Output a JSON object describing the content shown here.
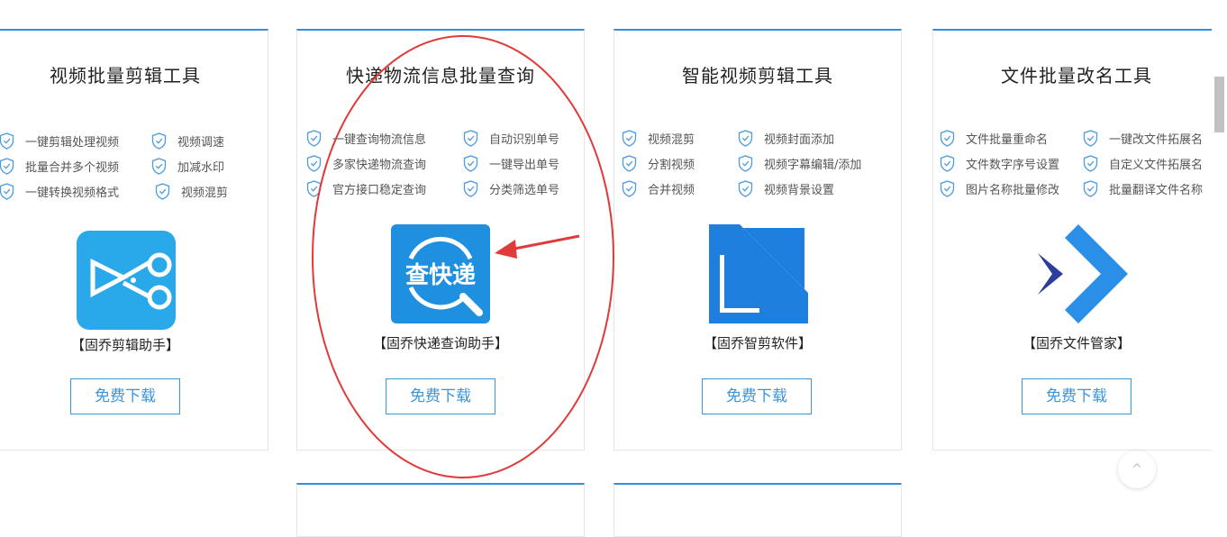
{
  "colors": {
    "accent": "#2f8fe0",
    "button": "#3b95d8",
    "annotation": "#e03a3a",
    "shield": "#4a9be0"
  },
  "cards": [
    {
      "title": "视频批量剪辑工具",
      "features": [
        "一键剪辑处理视频",
        "视频调速",
        "批量合并多个视频",
        "加减水印",
        "一键转换视频格式",
        "视频混剪"
      ],
      "product": "【固乔剪辑助手】",
      "button": "免费下载",
      "logo_icon": "scissors-icon"
    },
    {
      "title": "快递物流信息批量查询",
      "features": [
        "一键查询物流信息",
        "自动识别单号",
        "多家快递物流查询",
        "一键导出单号",
        "官方接口稳定查询",
        "分类筛选单号"
      ],
      "product": "【固乔快递查询助手】",
      "button": "免费下载",
      "logo_text": "查快递",
      "logo_icon": "magnifier-icon"
    },
    {
      "title": "智能视频剪辑工具",
      "features": [
        "视频混剪",
        "视频封面添加",
        "分割视频",
        "视频字幕编辑/添加",
        "合并视频",
        "视频背景设置"
      ],
      "product": "【固乔智剪软件】",
      "button": "免费下载",
      "logo_icon": "crop-icon"
    },
    {
      "title": "文件批量改名工具",
      "features": [
        "文件批量重命名",
        "一键改文件拓展名",
        "文件数字序号设置",
        "自定义文件拓展名",
        "图片名称批量修改",
        "批量翻译文件名称"
      ],
      "product": "【固乔文件管家】",
      "button": "免费下载",
      "logo_icon": "arrow-diamond-icon"
    }
  ],
  "back_to_top": "^"
}
